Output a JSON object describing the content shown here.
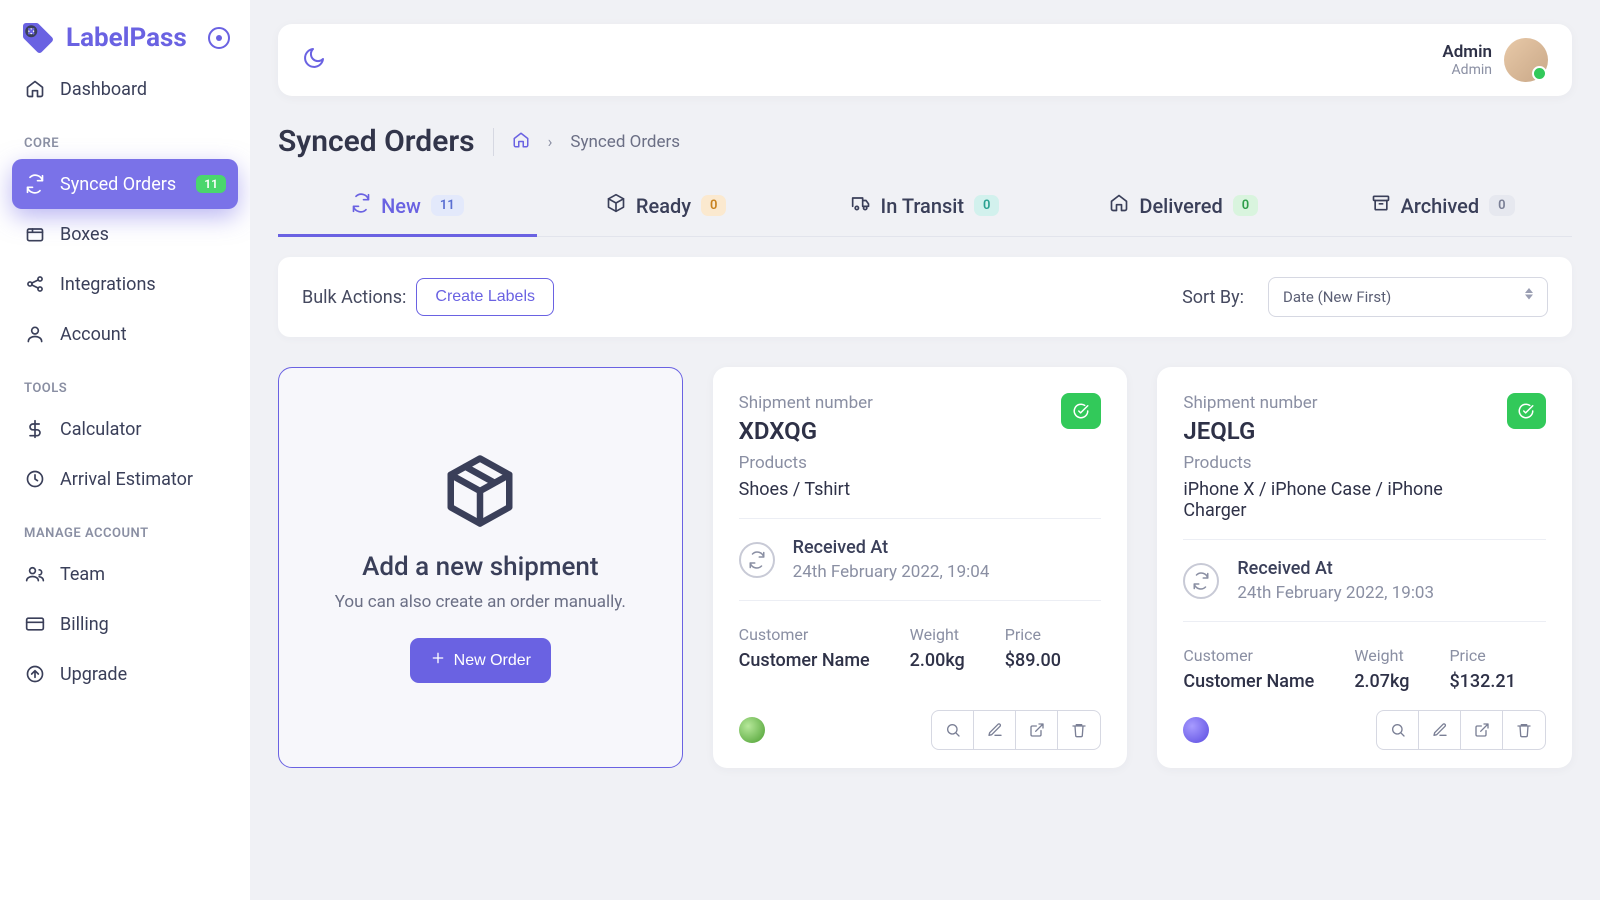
{
  "app_name": "LabelPass",
  "header": {
    "user_name": "Admin",
    "user_role": "Admin"
  },
  "page": {
    "title": "Synced Orders",
    "breadcrumb": "Synced Orders"
  },
  "sidebar": {
    "dashboard": "Dashboard",
    "sections": {
      "core": "CORE",
      "tools": "TOOLS",
      "manage": "MANAGE ACCOUNT"
    },
    "core": [
      {
        "label": "Synced Orders",
        "badge": "11"
      },
      {
        "label": "Boxes"
      },
      {
        "label": "Integrations"
      },
      {
        "label": "Account"
      }
    ],
    "tools": [
      {
        "label": "Calculator"
      },
      {
        "label": "Arrival Estimator"
      }
    ],
    "manage": [
      {
        "label": "Team"
      },
      {
        "label": "Billing"
      },
      {
        "label": "Upgrade"
      }
    ]
  },
  "tabs": [
    {
      "label": "New",
      "count": "11"
    },
    {
      "label": "Ready",
      "count": "0"
    },
    {
      "label": "In Transit",
      "count": "0"
    },
    {
      "label": "Delivered",
      "count": "0"
    },
    {
      "label": "Archived",
      "count": "0"
    }
  ],
  "toolbar": {
    "bulk_label": "Bulk Actions:",
    "create_labels": "Create Labels",
    "sort_by": "Sort By:",
    "sort_value": "Date (New First)"
  },
  "new_shipment": {
    "title": "Add a new shipment",
    "subtitle": "You can also create an order manually.",
    "button": "New Order"
  },
  "labels": {
    "shipment_number": "Shipment number",
    "products": "Products",
    "received_at": "Received At",
    "customer": "Customer",
    "weight": "Weight",
    "price": "Price"
  },
  "orders": [
    {
      "id": "XDXQG",
      "products": "Shoes / Tshirt",
      "received": "24th February 2022, 19:04",
      "customer": "Customer Name",
      "weight": "2.00kg",
      "price": "$89.00"
    },
    {
      "id": "JEQLG",
      "products": "iPhone X / iPhone Case / iPhone Charger",
      "received": "24th February 2022, 19:03",
      "customer": "Customer Name",
      "weight": "2.07kg",
      "price": "$132.21"
    }
  ]
}
